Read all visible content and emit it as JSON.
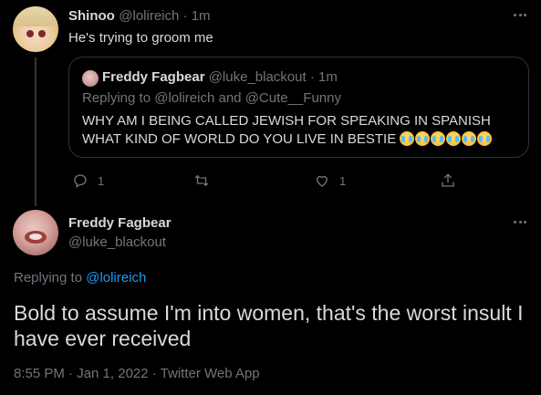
{
  "tweet1": {
    "display_name": "Shinoo",
    "handle": "@lolireich",
    "separator": " · ",
    "time": "1m",
    "text": "He's trying to groom me"
  },
  "quoted": {
    "display_name": "Freddy Fagbear",
    "handle": "@luke_blackout",
    "separator": " · ",
    "time": "1m",
    "replying_prefix": "Replying to ",
    "replying_to_1": "@lolireich",
    "replying_and": " and ",
    "replying_to_2": "@Cute__Funny",
    "text": "WHY AM I BEING CALLED JEWISH FOR SPEAKING IN SPANISH WHAT KIND OF WORLD DO YOU LIVE IN BESTIE",
    "emoji_count": 6,
    "emoji_name": "loudly-crying-face"
  },
  "actions": {
    "reply_count": "1",
    "retweet_count": "",
    "like_count": "1"
  },
  "tweet2": {
    "display_name": "Freddy Fagbear",
    "handle": "@luke_blackout",
    "replying_prefix": "Replying to ",
    "replying_to": "@lolireich",
    "text": "Bold to assume I'm into women, that's the worst insult I have ever received",
    "meta": "8:55 PM · Jan 1, 2022 · Twitter Web App"
  },
  "colors": {
    "background": "#000000",
    "text": "#d9d9d9",
    "muted": "#6e767d",
    "link": "#1d9bf0",
    "border": "#2f3336"
  }
}
